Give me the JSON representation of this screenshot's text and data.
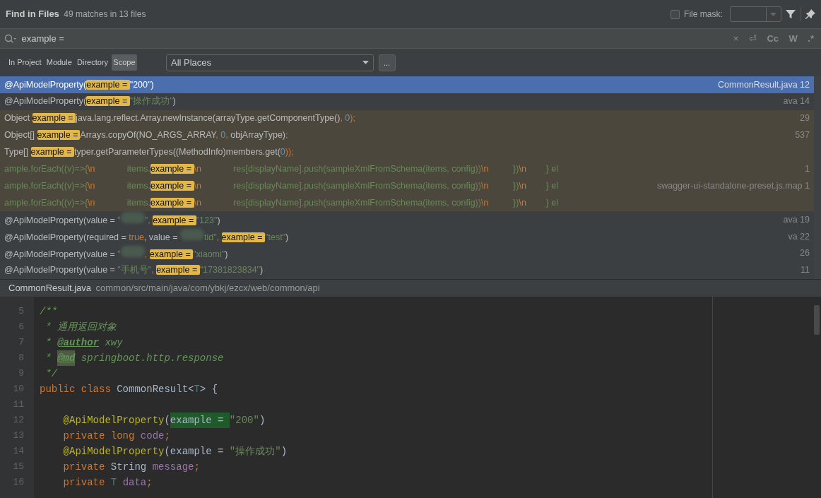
{
  "header": {
    "title": "Find in Files",
    "summary": "49 matches in 13 files",
    "file_mask": {
      "label": "File mask:",
      "checked": false
    }
  },
  "search": {
    "value": "example =",
    "options": [
      {
        "label": "×",
        "kind": "clear"
      },
      {
        "label": "⏎",
        "kind": "newline"
      },
      {
        "label": "Cc",
        "kind": "toggle",
        "on": false
      },
      {
        "label": "W",
        "kind": "toggle",
        "on": false
      },
      {
        "label": ".*",
        "kind": "toggle",
        "on": false
      }
    ]
  },
  "scopes": [
    {
      "label": "In Project",
      "selected": false
    },
    {
      "label": "Module",
      "selected": false
    },
    {
      "label": "Directory",
      "selected": false
    },
    {
      "label": "Scope",
      "selected": true
    }
  ],
  "scope_select": {
    "value": "All Places",
    "more": "..."
  },
  "results": [
    {
      "selected": true,
      "kind": "project",
      "file": "CommonResult.java 12",
      "segments": [
        {
          "t": "@ApiModelProperty(",
          "kind": "plain"
        },
        {
          "t": "example = ",
          "kind": "match"
        },
        {
          "t": "\"200\")",
          "kind": "plain"
        }
      ]
    },
    {
      "selected": false,
      "kind": "project",
      "file": "ava 14",
      "segments": [
        {
          "t": "@ApiModelProperty(",
          "kind": "plain"
        },
        {
          "t": "example = ",
          "kind": "match"
        },
        {
          "t": "\"操作成功\"",
          "kind": "string"
        },
        {
          "t": ")",
          "kind": "plain"
        }
      ]
    },
    {
      "selected": false,
      "kind": "library",
      "file": "29",
      "segments": [
        {
          "t": "Object ",
          "kind": "plain"
        },
        {
          "t": "example = ",
          "kind": "match"
        },
        {
          "t": "java.lang.reflect.Array.newInstance(arrayType.getComponentType()",
          "kind": "plain"
        },
        {
          "t": ", ",
          "kind": "punct"
        },
        {
          "t": "0",
          "kind": "number"
        },
        {
          "t": ");",
          "kind": "punct"
        }
      ]
    },
    {
      "selected": false,
      "kind": "library",
      "file": "537",
      "segments": [
        {
          "t": "Object[] ",
          "kind": "plain"
        },
        {
          "t": "example = ",
          "kind": "match"
        },
        {
          "t": "Arrays.copyOf(NO_ARGS_ARRAY",
          "kind": "plain"
        },
        {
          "t": ", ",
          "kind": "punct"
        },
        {
          "t": "0",
          "kind": "number"
        },
        {
          "t": ", ",
          "kind": "punct"
        },
        {
          "t": "objArrayType)",
          "kind": "plain"
        },
        {
          "t": ";",
          "kind": "punct"
        }
      ]
    },
    {
      "selected": false,
      "kind": "library",
      "segments": [
        {
          "t": "Type[] ",
          "kind": "plain"
        },
        {
          "t": "example = ",
          "kind": "match"
        },
        {
          "t": "typer.getParameterTypes((MethodInfo)members.get(",
          "kind": "plain"
        },
        {
          "t": "0",
          "kind": "number"
        },
        {
          "t": "));",
          "kind": "punct"
        }
      ]
    },
    {
      "selected": false,
      "kind": "library",
      "file": "1",
      "segments": [
        {
          "t": "ample.forEach((v)=>{",
          "kind": "string"
        },
        {
          "t": "\\n",
          "kind": "escape"
        },
        {
          "t": "             items.",
          "kind": "string"
        },
        {
          "t": "example = ",
          "kind": "match"
        },
        {
          "t": "\\n",
          "kind": "escape"
        },
        {
          "t": "             res[displayName].push(sampleXmlFromSchema(items, config))",
          "kind": "string"
        },
        {
          "t": "\\n",
          "kind": "escape"
        },
        {
          "t": "          })",
          "kind": "string"
        },
        {
          "t": "\\n",
          "kind": "escape"
        },
        {
          "t": "        } el",
          "kind": "string"
        }
      ]
    },
    {
      "selected": false,
      "kind": "library",
      "file": "swagger-ui-standalone-preset.js.map 1",
      "segments": [
        {
          "t": "ample.forEach((v)=>{",
          "kind": "string"
        },
        {
          "t": "\\n",
          "kind": "escape"
        },
        {
          "t": "             items.",
          "kind": "string"
        },
        {
          "t": "example = ",
          "kind": "match"
        },
        {
          "t": "\\n",
          "kind": "escape"
        },
        {
          "t": "             res[displayName].push(sampleXmlFromSchema(items, config))",
          "kind": "string"
        },
        {
          "t": "\\n",
          "kind": "escape"
        },
        {
          "t": "          })",
          "kind": "string"
        },
        {
          "t": "\\n",
          "kind": "escape"
        },
        {
          "t": "        } el",
          "kind": "string"
        }
      ]
    },
    {
      "selected": false,
      "kind": "library",
      "segments": [
        {
          "t": "ample.forEach((v)=>{",
          "kind": "string"
        },
        {
          "t": "\\n",
          "kind": "escape"
        },
        {
          "t": "             items.",
          "kind": "string"
        },
        {
          "t": "example = ",
          "kind": "match"
        },
        {
          "t": "\\n",
          "kind": "escape"
        },
        {
          "t": "             res[displayName].push(sampleXmlFromSchema(items, config))",
          "kind": "string"
        },
        {
          "t": "\\n",
          "kind": "escape"
        },
        {
          "t": "          })",
          "kind": "string"
        },
        {
          "t": "\\n",
          "kind": "escape"
        },
        {
          "t": "        } el",
          "kind": "string"
        }
      ]
    },
    {
      "selected": false,
      "kind": "project",
      "file": "ava 19",
      "segments": [
        {
          "t": "@ApiModelProperty(value = ",
          "kind": "plain"
        },
        {
          "t": "\"",
          "kind": "string"
        },
        {
          "kind": "redacted"
        },
        {
          "t": "\", ",
          "kind": "string"
        },
        {
          "t": "example = ",
          "kind": "match"
        },
        {
          "t": "\"123\"",
          "kind": "string"
        },
        {
          "t": ")",
          "kind": "plain"
        }
      ]
    },
    {
      "selected": false,
      "kind": "project",
      "file": "va 22",
      "segments": [
        {
          "t": "@ApiModelProperty(required = ",
          "kind": "plain"
        },
        {
          "t": "true",
          "kind": "keyword"
        },
        {
          "t": ", value = ",
          "kind": "plain"
        },
        {
          "kind": "redacted"
        },
        {
          "t": "tid\"",
          "kind": "string"
        },
        {
          "t": ", ",
          "kind": "punct"
        },
        {
          "t": "example = ",
          "kind": "match"
        },
        {
          "t": "\"test\"",
          "kind": "string"
        },
        {
          "t": ")",
          "kind": "plain"
        }
      ]
    },
    {
      "selected": false,
      "kind": "project",
      "file": "26",
      "segments": [
        {
          "t": "@ApiModelProperty(value = ",
          "kind": "plain"
        },
        {
          "t": "\"",
          "kind": "string"
        },
        {
          "kind": "redacted"
        },
        {
          "t": ", ",
          "kind": "punct"
        },
        {
          "t": "example = ",
          "kind": "match"
        },
        {
          "t": "\"xiaomi\"",
          "kind": "string"
        },
        {
          "t": ")",
          "kind": "plain"
        }
      ]
    },
    {
      "selected": false,
      "kind": "project",
      "file": "11",
      "segments": [
        {
          "t": "@ApiModelProperty(value = ",
          "kind": "plain"
        },
        {
          "t": "\"手机号\"",
          "kind": "string"
        },
        {
          "t": ", ",
          "kind": "punct"
        },
        {
          "t": "example = ",
          "kind": "match"
        },
        {
          "t": "\"17381823834\"",
          "kind": "string"
        },
        {
          "t": ")",
          "kind": "plain"
        }
      ]
    }
  ],
  "preview": {
    "file": "CommonResult.java",
    "path": "common/src/main/java/com/ybkj/ezcx/web/common/api",
    "lines": [
      {
        "n": "5",
        "tokens": [
          {
            "t": "/**",
            "kind": "doc"
          }
        ]
      },
      {
        "n": "6",
        "tokens": [
          {
            "t": " * 通用返回对象",
            "kind": "doc"
          }
        ]
      },
      {
        "n": "7",
        "tokens": [
          {
            "t": " * ",
            "kind": "doc"
          },
          {
            "t": "@author",
            "kind": "doctag"
          },
          {
            "t": " xwy",
            "kind": "doc"
          }
        ]
      },
      {
        "n": "8",
        "tokens": [
          {
            "t": " * ",
            "kind": "doc"
          },
          {
            "t": "@md",
            "kind": "doctag-unknown"
          },
          {
            "t": " springboot.http.response",
            "kind": "doc"
          }
        ]
      },
      {
        "n": "9",
        "tokens": [
          {
            "t": " */",
            "kind": "doc"
          }
        ]
      },
      {
        "n": "10",
        "tokens": [
          {
            "t": "public class ",
            "kind": "keyword"
          },
          {
            "t": "CommonResult<",
            "kind": "plain"
          },
          {
            "t": "T",
            "kind": "typeparam"
          },
          {
            "t": "> {",
            "kind": "plain"
          }
        ]
      },
      {
        "n": "11"
      },
      {
        "n": "12",
        "tokens": [
          {
            "t": "    @ApiModelProperty",
            "kind": "annotation"
          },
          {
            "t": "(",
            "kind": "plain"
          },
          {
            "t": "example = ",
            "kind": "found"
          },
          {
            "t": "\"200\"",
            "kind": "string"
          },
          {
            "t": ")",
            "kind": "plain"
          }
        ]
      },
      {
        "n": "13",
        "tokens": [
          {
            "t": "    private long ",
            "kind": "keyword"
          },
          {
            "t": "code",
            "kind": "field"
          },
          {
            "t": ";",
            "kind": "keyword"
          }
        ]
      },
      {
        "n": "14",
        "tokens": [
          {
            "t": "    @ApiModelProperty",
            "kind": "annotation"
          },
          {
            "t": "(example = ",
            "kind": "plain"
          },
          {
            "t": "\"操作成功\"",
            "kind": "string"
          },
          {
            "t": ")",
            "kind": "plain"
          }
        ]
      },
      {
        "n": "15",
        "tokens": [
          {
            "t": "    private ",
            "kind": "keyword"
          },
          {
            "t": "String ",
            "kind": "plain"
          },
          {
            "t": "message",
            "kind": "field"
          },
          {
            "t": ";",
            "kind": "keyword"
          }
        ]
      },
      {
        "n": "16",
        "tokens": [
          {
            "t": "    private ",
            "kind": "keyword"
          },
          {
            "t": "T ",
            "kind": "typeparam"
          },
          {
            "t": "data",
            "kind": "field"
          },
          {
            "t": ";",
            "kind": "keyword"
          }
        ]
      }
    ]
  }
}
